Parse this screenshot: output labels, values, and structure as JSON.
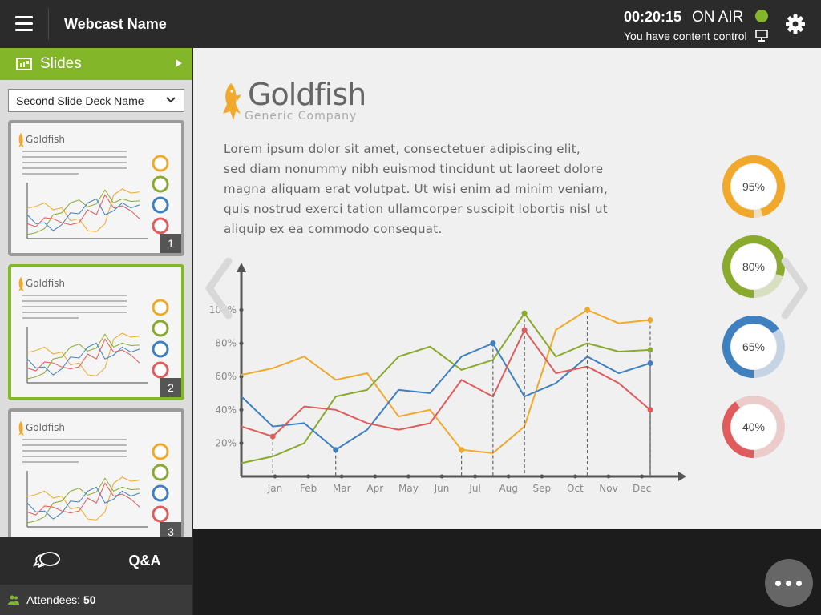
{
  "header": {
    "title": "Webcast Name",
    "timer": "00:20:15",
    "status": "ON AIR",
    "control_text": "You have content control"
  },
  "sidebar": {
    "section_label": "Slides",
    "deck_name": "Second Slide Deck Name",
    "thumbnails": [
      {
        "number": "1",
        "active": false
      },
      {
        "number": "2",
        "active": true
      },
      {
        "number": "3",
        "active": false
      }
    ]
  },
  "footer": {
    "qa_label": "Q&A",
    "attendees_label": "Attendees:",
    "attendees_count": "50"
  },
  "slide": {
    "brand": "Goldfish",
    "tagline": "Generic Company",
    "body_lines": [
      "Lorem ipsum dolor sit amet, consectetuer adipiscing elit,",
      "sed diam nonummy nibh euismod tincidunt ut laoreet dolore",
      "magna aliquam erat volutpat. Ut wisi enim ad minim veniam,",
      "quis nostrud exerci tation ullamcorper suscipit lobortis nisl ut",
      "aliquip ex ea commodo consequat."
    ]
  },
  "chart_data": {
    "type": "line",
    "categories": [
      "Jan",
      "Feb",
      "Mar",
      "Apr",
      "May",
      "Jun",
      "Jul",
      "Aug",
      "Sep",
      "Oct",
      "Nov",
      "Dec"
    ],
    "y_tick_labels": [
      "20%",
      "40%",
      "60%",
      "80%",
      "100%"
    ],
    "ylim": [
      0,
      100
    ],
    "series": [
      {
        "color": "#f0a92a",
        "values": [
          61,
          65,
          72,
          58,
          62,
          36,
          40,
          16,
          14,
          30,
          88,
          100,
          92,
          94
        ]
      },
      {
        "color": "#8aaa2e",
        "values": [
          8,
          12,
          20,
          48,
          52,
          72,
          78,
          64,
          70,
          98,
          72,
          80,
          75,
          76
        ]
      },
      {
        "color": "#3e80c0",
        "values": [
          48,
          30,
          32,
          16,
          28,
          52,
          50,
          72,
          80,
          48,
          56,
          72,
          62,
          68
        ]
      },
      {
        "color": "#e05c5c",
        "values": [
          30,
          24,
          42,
          40,
          32,
          28,
          32,
          58,
          48,
          88,
          62,
          66,
          56,
          40
        ]
      }
    ],
    "x_positions": [
      0,
      0.5,
      1,
      1.5,
      2,
      2.5,
      3,
      3.5,
      4,
      4.5,
      5,
      5.5,
      6,
      6.5
    ],
    "gauges": [
      {
        "label": "95%",
        "value": 95,
        "color": "#f0a92a"
      },
      {
        "label": "80%",
        "value": 80,
        "color": "#8aaa2e"
      },
      {
        "label": "65%",
        "value": 65,
        "color": "#3e80c0"
      },
      {
        "label": "40%",
        "value": 40,
        "color": "#e05c5c"
      }
    ],
    "grid": false
  },
  "colors": {
    "accent": "#84b62a",
    "topbar": "#2b2b2b",
    "on_air": "#84b62a"
  },
  "icons": {
    "menu": "hamburger-icon",
    "settings": "gear-icon",
    "presenter": "monitor-icon",
    "chat": "chat-bubbles-icon",
    "more": "more-dots-icon",
    "attendees": "people-icon"
  }
}
